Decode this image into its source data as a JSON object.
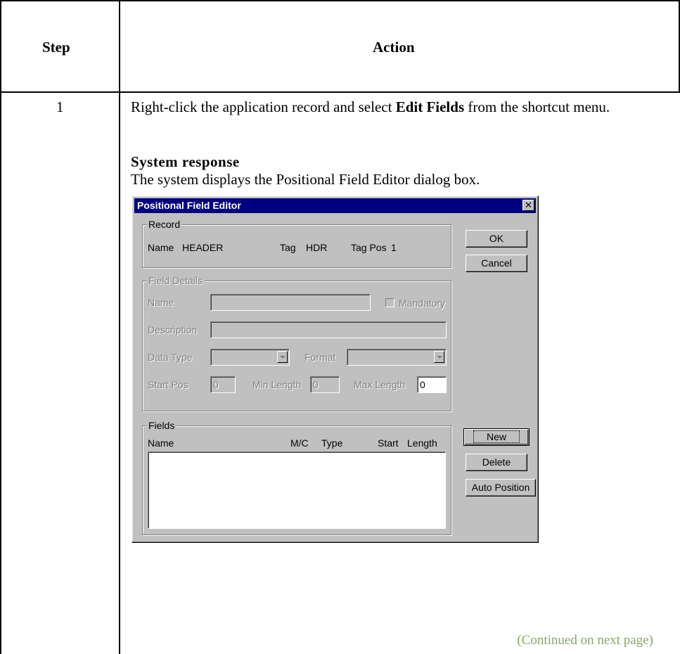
{
  "table": {
    "header_step": "Step",
    "header_action": "Action",
    "step_number": "1",
    "instruction_prefix": "Right-click the application record and select ",
    "instruction_bold": "Edit Fields",
    "instruction_suffix": " from the shortcut menu.",
    "system_response_heading": "System response",
    "system_response_text": "The system displays the Positional Field Editor dialog box.",
    "continued": "(Continued on next page)"
  },
  "dialog": {
    "title": "Positional Field Editor",
    "close_glyph": "✕",
    "record": {
      "group_label": "Record",
      "name_label": "Name",
      "name_value": "HEADER",
      "tag_label": "Tag",
      "tag_value": "HDR",
      "tagpos_label": "Tag Pos",
      "tagpos_value": "1"
    },
    "field_details": {
      "group_label": "Field Details",
      "name_label": "Name",
      "mandatory_label": "Mandatory",
      "description_label": "Description",
      "data_type_label": "Data Type",
      "format_label": "Format",
      "start_pos_label": "Start Pos",
      "start_pos_value": "0",
      "min_length_label": "Min Length",
      "min_length_value": "0",
      "max_length_label": "Max Length",
      "max_length_value": "0"
    },
    "fields": {
      "group_label": "Fields",
      "columns": [
        "Name",
        "M/C",
        "Type",
        "Start",
        "Length"
      ],
      "rows": []
    },
    "buttons": {
      "ok": "OK",
      "cancel": "Cancel",
      "new": "New",
      "delete": "Delete",
      "auto_position": "Auto Position"
    }
  }
}
